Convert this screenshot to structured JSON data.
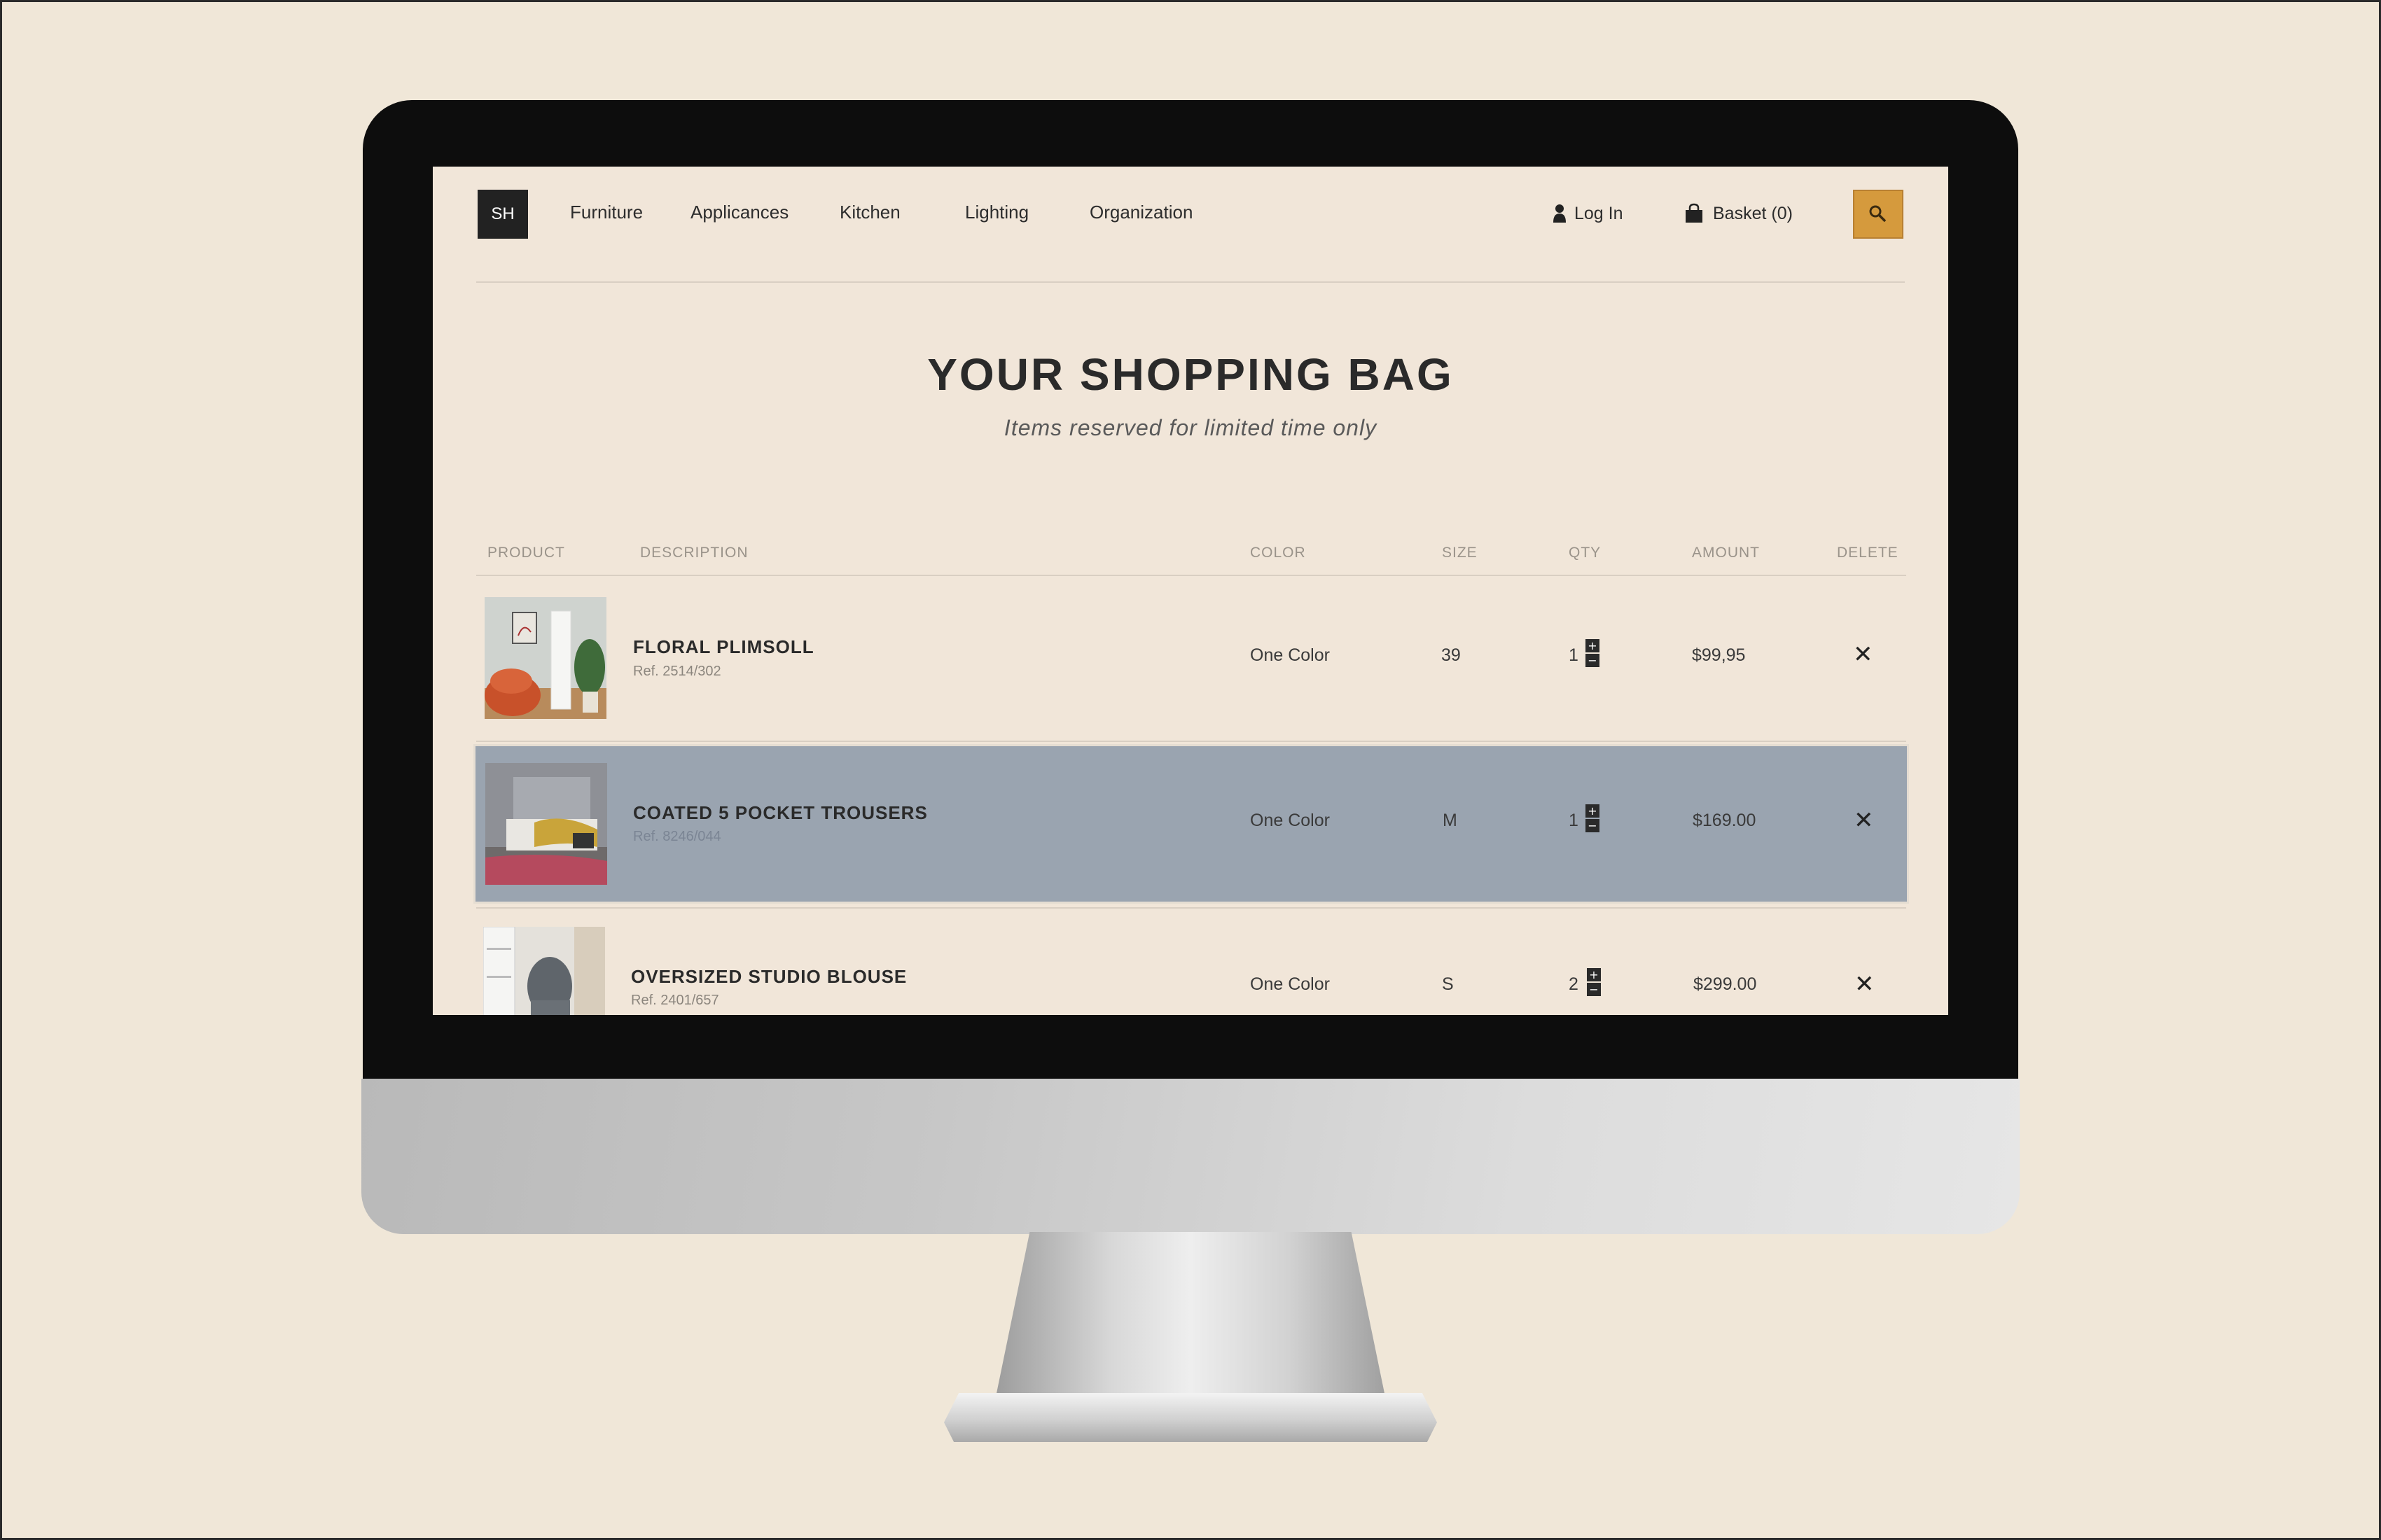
{
  "nav": {
    "logo": "SH",
    "links": [
      "Furniture",
      "Applicances",
      "Kitchen",
      "Lighting",
      "Organization"
    ],
    "login_label": "Log In",
    "basket_label": "Basket (0)",
    "search_icon": "search-icon",
    "accent_color": "#d59a3d"
  },
  "page": {
    "title": "YOUR SHOPPING BAG",
    "subtitle": "Items reserved for limited time only"
  },
  "table": {
    "headers": {
      "product": "PRODUCT",
      "description": "DESCRIPTION",
      "color": "COLOR",
      "size": "SIZE",
      "qty": "QTY",
      "amount": "AMOUNT",
      "delete": "DELETE"
    },
    "rows": [
      {
        "name": "FLORAL PLIMSOLL",
        "ref": "Ref. 2514/302",
        "color": "One Color",
        "size": "39",
        "qty": "1",
        "amount": "$99,95",
        "highlighted": false
      },
      {
        "name": "COATED 5 POCKET TROUSERS",
        "ref": "Ref. 8246/044",
        "color": "One Color",
        "size": "M",
        "qty": "1",
        "amount": "$169.00",
        "highlighted": true
      },
      {
        "name": "OVERSIZED STUDIO BLOUSE",
        "ref": "Ref. 2401/657",
        "color": "One Color",
        "size": "S",
        "qty": "2",
        "amount": "$299.00",
        "highlighted": false
      }
    ],
    "highlight_color": "#9aa4b0",
    "qty_plus": "+",
    "qty_minus": "−",
    "delete_glyph": "✕"
  }
}
